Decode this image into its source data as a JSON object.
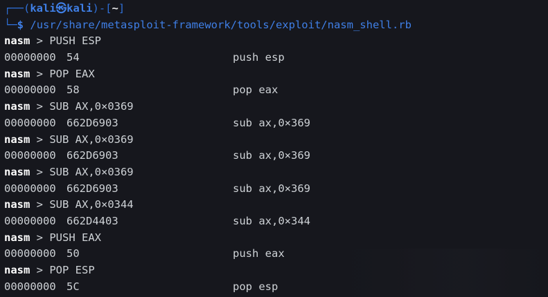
{
  "prompt": {
    "frame_top": "┌──(",
    "user": "kali",
    "skull": "㉿",
    "host": "kali",
    "close_paren": ")-[",
    "cwd": "~",
    "close_bracket": "]",
    "frame_bottom": "└─",
    "dollar": "$",
    "command": "/usr/share/metasploit-framework/tools/exploit/nasm_shell.rb"
  },
  "nasm_prompt": {
    "word": "nasm",
    "sep": " > "
  },
  "entries": [
    {
      "input": "PUSH ESP",
      "addr": "00000000",
      "hex": "54",
      "asm": "push esp"
    },
    {
      "input": "POP EAX",
      "addr": "00000000",
      "hex": "58",
      "asm": "pop eax"
    },
    {
      "input": "SUB AX,0×0369",
      "addr": "00000000",
      "hex": "662D6903",
      "asm": "sub ax,0×369"
    },
    {
      "input": "SUB AX,0×0369",
      "addr": "00000000",
      "hex": "662D6903",
      "asm": "sub ax,0×369"
    },
    {
      "input": "SUB AX,0×0369",
      "addr": "00000000",
      "hex": "662D6903",
      "asm": "sub ax,0×369"
    },
    {
      "input": "SUB AX,0×0344",
      "addr": "00000000",
      "hex": "662D4403",
      "asm": "sub ax,0×344"
    },
    {
      "input": "PUSH EAX",
      "addr": "00000000",
      "hex": "50",
      "asm": "push eax"
    },
    {
      "input": "POP ESP",
      "addr": "00000000",
      "hex": "5C",
      "asm": "pop esp"
    }
  ],
  "colors": {
    "background": "#16171d",
    "prompt_blue": "#3f7fe6",
    "text": "#ced2d6"
  }
}
